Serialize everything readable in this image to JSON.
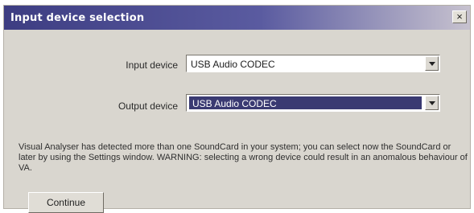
{
  "window": {
    "title": "Input device selection",
    "close_glyph": "×"
  },
  "form": {
    "input_device": {
      "label": "Input device",
      "value": "USB Audio CODEC"
    },
    "output_device": {
      "label": "Output device",
      "value": "USB Audio CODEC"
    }
  },
  "message": "Visual Analyser has detected more than one SoundCard in your system; you can select now the SoundCard or later by using the Settings window. WARNING: selecting a wrong device could result in an anomalous behaviour of VA.",
  "buttons": {
    "continue_label": "Continue"
  },
  "icons": {
    "close": "close-icon",
    "dropdown": "chevron-down-icon"
  },
  "colors": {
    "titlebar_start": "#3d3d82",
    "titlebar_end": "#c7c2cf",
    "dialog_bg": "#d9d6cf",
    "selection": "#3a3a72"
  }
}
